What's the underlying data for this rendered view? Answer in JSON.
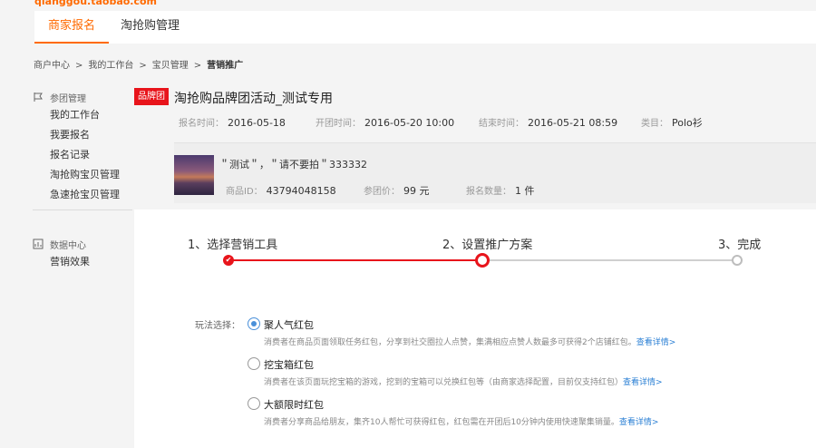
{
  "header": {
    "logo_text": "qianggou.taobao.com",
    "tabs": [
      {
        "label": "商家报名",
        "active": true
      },
      {
        "label": "淘抢购管理",
        "active": false
      }
    ]
  },
  "breadcrumb": [
    "商户中心",
    ">",
    "我的工作台",
    ">",
    "宝贝管理",
    ">",
    "营销推广"
  ],
  "sidebar": {
    "groups": [
      {
        "title": "参团管理",
        "icon": "flag-icon",
        "items": [
          "我的工作台",
          "我要报名",
          "报名记录",
          "淘抢购宝贝管理",
          "急速抢宝贝管理"
        ]
      },
      {
        "title": "数据中心",
        "icon": "chart-icon",
        "items": [
          "营销效果"
        ]
      }
    ]
  },
  "activity": {
    "badge": "品牌团",
    "title": "淘抢购品牌团活动_测试专用",
    "signup_label": "报名时间：",
    "signup_value": "2016-05-18",
    "start_label": "开团时间：",
    "start_value": "2016-05-20 10:00",
    "end_label": "结束时间：",
    "end_value": "2016-05-21 08:59",
    "category_label": "类目：",
    "category_value": "Polo衫"
  },
  "goods": {
    "name": "＂测试＂，＂请不要拍＂333332",
    "id_label": "商品ID：",
    "id_value": "43794048158",
    "price_label": "参团价：",
    "price_value": "99 元",
    "qty_label": "报名数量：",
    "qty_value": "1 件"
  },
  "steps": [
    {
      "label": "1、选择营销工具",
      "status": "done"
    },
    {
      "label": "2、设置推广方案",
      "status": "current"
    },
    {
      "label": "3、完成",
      "status": "todo"
    }
  ],
  "play": {
    "label": "玩法选择：",
    "options": [
      {
        "title": "聚人气红包",
        "selected": true,
        "desc": "消费者在商品页面领取任务红包，分享到社交圈拉人点赞，集满相应点赞人数最多可获得2个店铺红包。",
        "link": "查看详情>"
      },
      {
        "title": "挖宝箱红包",
        "selected": false,
        "desc": "消费者在该页面玩挖宝箱的游戏，挖到的宝箱可以兑换红包等（由商家选择配置，目前仅支持红包）",
        "link": "查看详情>"
      },
      {
        "title": "大额限时红包",
        "selected": false,
        "desc": "消费者分享商品给朋友，集齐10人帮忙可获得红包，红包需在开团后10分钟内使用快速聚集销量。",
        "link": "查看详情>"
      }
    ]
  },
  "colors": {
    "accent": "#ff6a00",
    "brand_red": "#e8141b",
    "link": "#2a7fd4",
    "radio": "#4a90d9"
  }
}
